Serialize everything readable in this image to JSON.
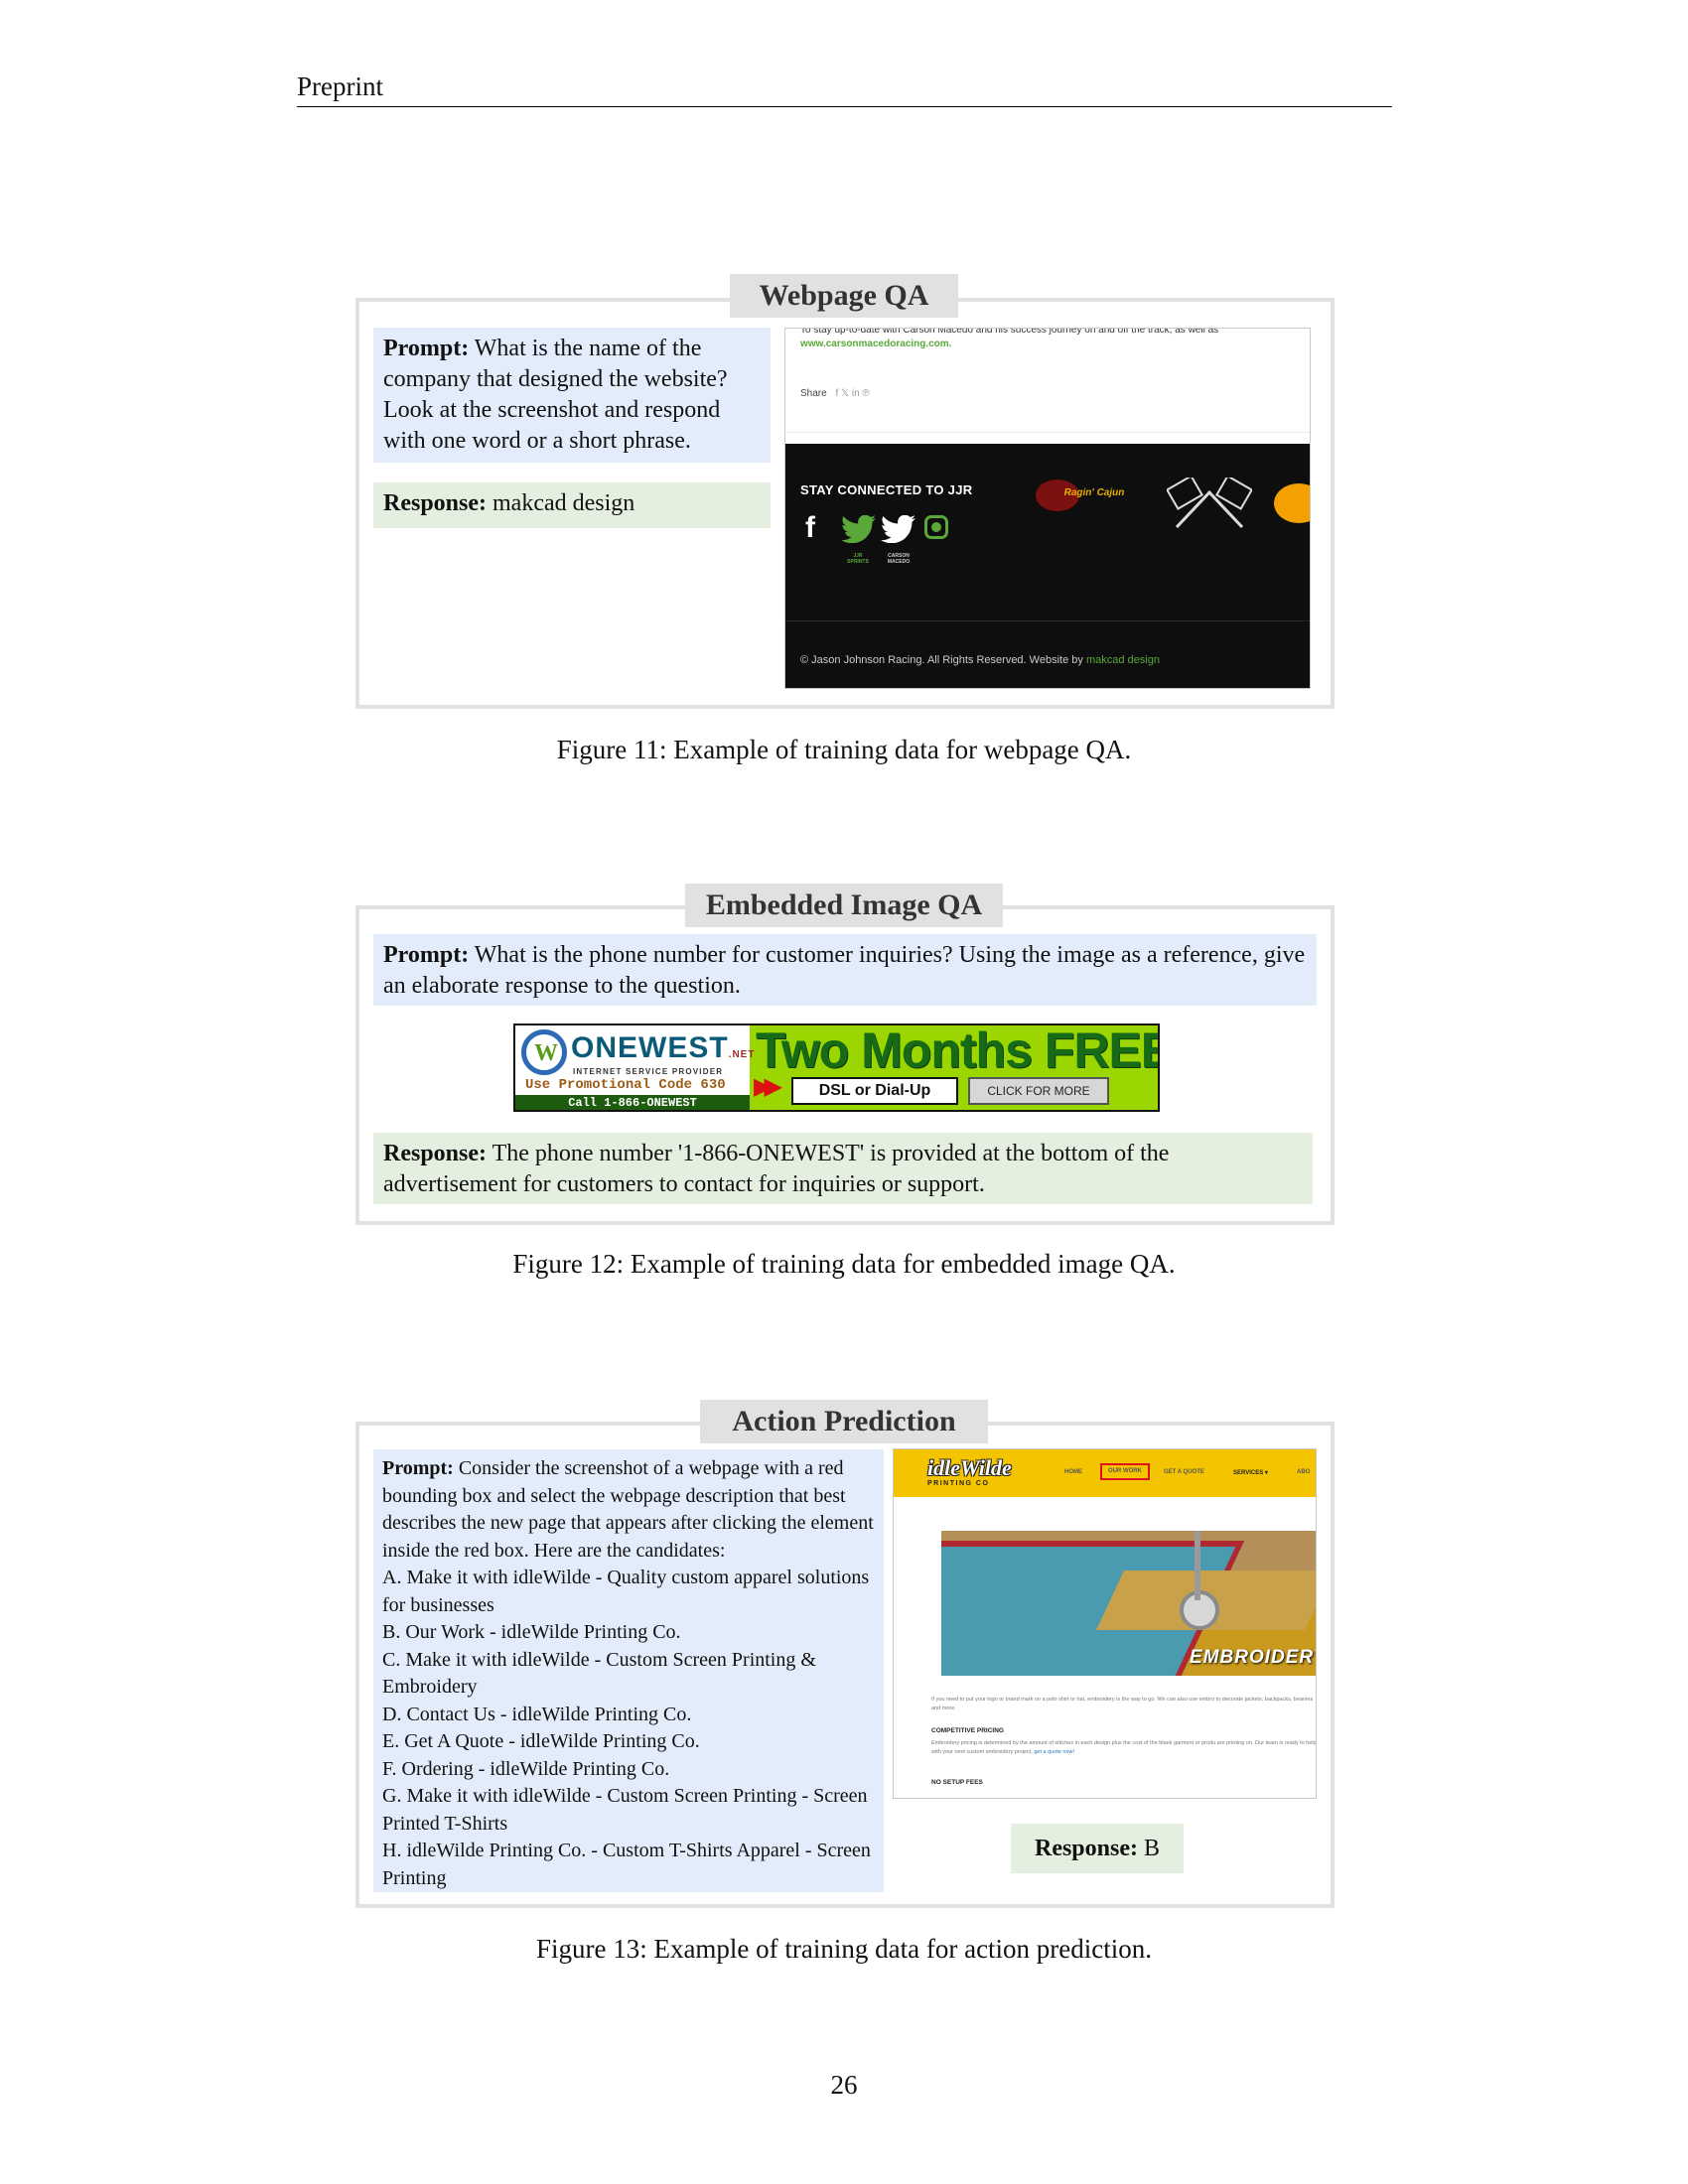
{
  "header": {
    "text": "Preprint"
  },
  "figures": [
    {
      "title": "Webpage QA",
      "prompt_label": "Prompt:",
      "prompt_text": "What is the name of the company that designed the website? Look at the screenshot and respond with one word or a short phrase.",
      "response_label": "Response:",
      "response_text": "makcad design",
      "caption": "Figure 11: Example of training data for webpage QA.",
      "screenshot": {
        "top_text": "To stay up-to-date with Carson Macedo and his success journey on and off the track, as well as",
        "link_text": "www.carsonmacedoracing.com.",
        "share_label": "Share",
        "share_icons": "f  𝕏  in  ℗",
        "stay_connected": "STAY CONNECTED TO JJR",
        "social_labels": [
          "JJR SPRINTS",
          "CARSON MACEDO"
        ],
        "footer_text": "© Jason Johnson Racing. All Rights Reserved. Website by",
        "footer_link": "makcad design",
        "logo_text": "Ragin' Cajun"
      }
    },
    {
      "title": "Embedded Image QA",
      "prompt_label": "Prompt:",
      "prompt_text": "What is the phone number for customer inquiries? Using the image as a reference, give an elaborate response to the question.",
      "response_label": "Response:",
      "response_text": "The phone number '1-866-ONEWEST' is provided at the bottom of the advertisement for customers to contact for inquiries or support.",
      "caption": "Figure 12: Example of training data for embedded image QA.",
      "banner": {
        "brand": "ONEWEST",
        "brand_suffix": ".NET",
        "tagline": "INTERNET SERVICE PROVIDER",
        "promo": "Use Promotional Code 630",
        "call": "Call 1-866-ONEWEST",
        "headline": "Two Months FREE!",
        "option": "DSL or Dial-Up",
        "cta": "CLICK FOR MORE"
      }
    },
    {
      "title": "Action Prediction",
      "prompt_label": "Prompt:",
      "prompt_intro": "Consider the screenshot of a webpage with a red bounding box and select the webpage description that best describes the new page that appears after clicking the element inside the red box. Here are the candidates:",
      "options": [
        "A. Make it with idleWilde - Quality custom apparel solutions for businesses",
        "B. Our Work - idleWilde Printing Co.",
        "C. Make it with idleWilde - Custom Screen Printing & Embroidery",
        "D. Contact Us - idleWilde Printing Co.",
        "E. Get A Quote - idleWilde Printing Co.",
        "F. Ordering - idleWilde Printing Co.",
        "G. Make it with idleWilde - Custom Screen Printing - Screen Printed T-Shirts",
        "H. idleWilde Printing Co. - Custom T-Shirts Apparel - Screen Printing"
      ],
      "response_label": "Response:",
      "response_text": "B",
      "caption": "Figure 13: Example of training data for action prediction.",
      "screenshot": {
        "logo": "idleWilde",
        "logo_sub": "PRINTING CO",
        "nav": [
          "HOME",
          "OUR WORK",
          "GET A QUOTE",
          "SERVICES ▾",
          "ABO"
        ],
        "hero_label": "EMBROIDERY",
        "body_text": "If you need to put your logo or brand mark on a polo shirt or hat, embroidery is the way to go. We can also use embro to decorate jackets, backpacks, beanies and more.",
        "heading1": "COMPETITIVE PRICING",
        "body_text2": "Embroidery pricing is determined by the amount of stitches in each design plus the cost of the blank garment or produ are printing on. Our team is ready to help with your next custom embroidery project,",
        "body_link": "get a quote now!",
        "heading2": "NO SETUP FEES"
      }
    }
  ],
  "page_number": "26",
  "colors": {
    "prompt_bg": "#e3ecfa",
    "response_bg": "#e4efdf",
    "panel_border": "#e1e1e1",
    "accent_green": "#5aa83a",
    "banner_green": "#9bd600",
    "idlewilde_yellow": "#f5c400"
  }
}
